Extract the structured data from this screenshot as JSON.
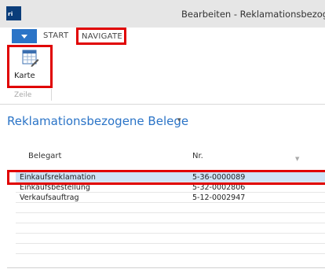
{
  "window": {
    "title": "Bearbeiten - Reklamationsbezoge",
    "app_icon_glyph": "rtl"
  },
  "ribbon": {
    "tabs": [
      {
        "label": "START"
      },
      {
        "label": "NAVIGATE",
        "highlighted": true
      }
    ],
    "buttons": [
      {
        "label": "Karte",
        "icon": "card-table-edit-icon",
        "highlighted": true
      }
    ],
    "group_label": "Zeile"
  },
  "page": {
    "title": "Reklamationsbezogene Belege",
    "title_dropdown_glyph": "▾"
  },
  "table": {
    "columns": [
      "Belegart",
      "Nr."
    ],
    "rows": [
      {
        "belegart": "Einkaufsreklamation",
        "nr": "5-36-0000089",
        "selected": true
      },
      {
        "belegart": "Einkaufsbestellung",
        "nr": "5-32-0002806"
      },
      {
        "belegart": "Verkaufsauftrag",
        "nr": "5-12-0002947"
      }
    ]
  },
  "colors": {
    "accent": "#2b74c7",
    "highlight": "#e00000",
    "selection": "#cfe3f6"
  }
}
